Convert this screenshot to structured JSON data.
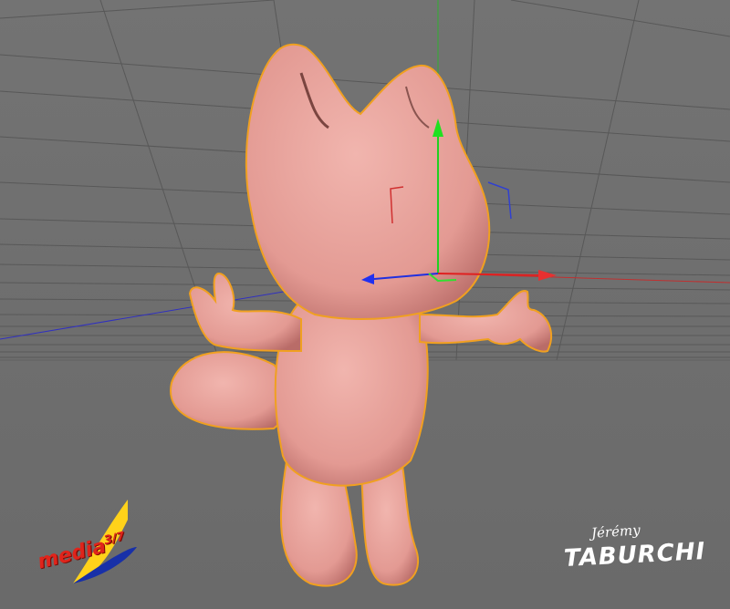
{
  "viewport": {
    "colors": {
      "background": "#6f6f6f",
      "grid": "#5c5c5c",
      "model_skin": "#e7a39d",
      "selection_outline": "#f0a020",
      "axis_x": "#e02020",
      "axis_y": "#20c020",
      "axis_z": "#2020e0"
    }
  },
  "model": {
    "icon": "cartoon-fox-character"
  },
  "logos": {
    "left_text": "media",
    "left_sup": "3/7",
    "signature_small": "Jérémy",
    "signature_big": "TABURCHI"
  }
}
